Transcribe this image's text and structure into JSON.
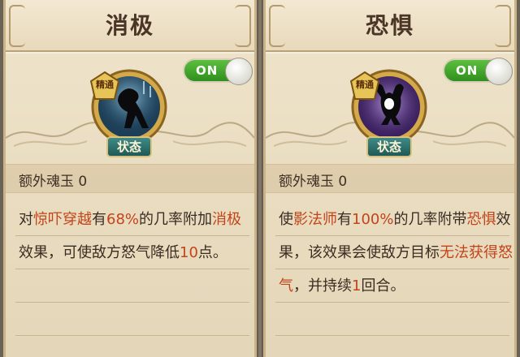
{
  "cards": [
    {
      "title": "消极",
      "toggle": "ON",
      "badge": "精通",
      "status_tag": "状态",
      "bonus_label": "额外魂玉",
      "bonus_value": "0",
      "description": [
        {
          "text": "对",
          "hl": false
        },
        {
          "text": "惊吓穿越",
          "hl": true
        },
        {
          "text": "有",
          "hl": false
        },
        {
          "text": "68%",
          "hl": true
        },
        {
          "text": "的几率附加",
          "hl": false
        },
        {
          "text": "消极",
          "hl": true
        },
        {
          "text": "效果，可使敌方怒气降低",
          "hl": false
        },
        {
          "text": "10",
          "hl": true
        },
        {
          "text": "点。",
          "hl": false
        }
      ],
      "icon": "despair-figure-icon",
      "colors": {
        "icon_bg": "#1c3e57",
        "icon_glow": "#9fd6f0"
      }
    },
    {
      "title": "恐惧",
      "toggle": "ON",
      "badge": "精通",
      "status_tag": "状态",
      "bonus_label": "额外魂玉",
      "bonus_value": "0",
      "description": [
        {
          "text": "使",
          "hl": false
        },
        {
          "text": "影法师",
          "hl": true
        },
        {
          "text": "有",
          "hl": false
        },
        {
          "text": "100%",
          "hl": true
        },
        {
          "text": "的几率附带",
          "hl": false
        },
        {
          "text": "恐惧",
          "hl": true
        },
        {
          "text": "效果，该效果会使敌方目标",
          "hl": false
        },
        {
          "text": "无法获得怒气",
          "hl": true
        },
        {
          "text": "，并持续",
          "hl": false
        },
        {
          "text": "1",
          "hl": true
        },
        {
          "text": "回合。",
          "hl": false
        }
      ],
      "icon": "fear-figure-icon",
      "colors": {
        "icon_bg": "#3a1f5e",
        "icon_glow": "#c7a8f0"
      }
    }
  ],
  "colors": {
    "highlight": "#c2441a",
    "toggle_on": "#3fa52a",
    "parchment": "#ebdfc4",
    "title_text": "#4a3526"
  }
}
